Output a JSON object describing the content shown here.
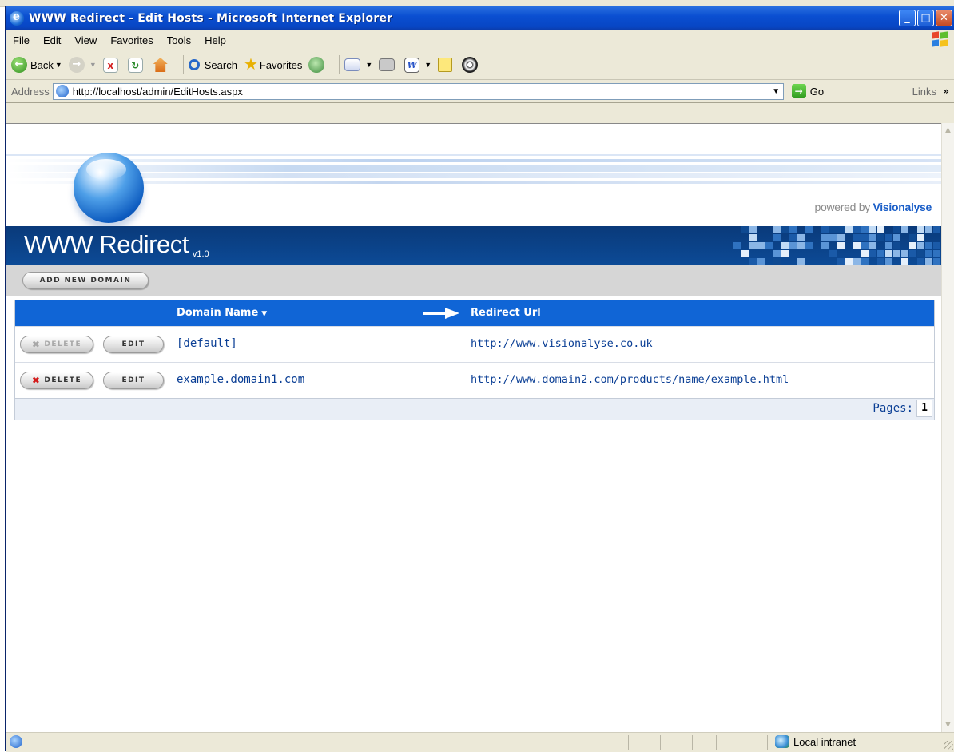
{
  "window": {
    "title": "WWW Redirect - Edit Hosts - Microsoft Internet Explorer",
    "minimize": "_",
    "maximize": "□",
    "close": "✕"
  },
  "menu": [
    "File",
    "Edit",
    "View",
    "Favorites",
    "Tools",
    "Help"
  ],
  "toolbar": {
    "back": "Back",
    "search": "Search",
    "favorites": "Favorites"
  },
  "address": {
    "label": "Address",
    "url": "http://localhost/admin/EditHosts.aspx",
    "go": "Go",
    "links": "Links"
  },
  "page": {
    "powered_by_prefix": "powered by",
    "powered_by_brand": "Visionalyse",
    "app_name": "WWW Redirect",
    "version": "v1.0",
    "add_button": "ADD NEW DOMAIN",
    "columns": {
      "domain": "Domain Name",
      "redirect": "Redirect Url"
    },
    "rows": [
      {
        "delete_label": "DELETE",
        "delete_enabled": false,
        "edit_label": "EDIT",
        "domain": "[default]",
        "redirect": "http://www.visionalyse.co.uk"
      },
      {
        "delete_label": "DELETE",
        "delete_enabled": true,
        "edit_label": "EDIT",
        "domain": "example.domain1.com",
        "redirect": "http://www.domain2.com/products/name/example.html"
      }
    ],
    "pager_label": "Pages:",
    "current_page": "1"
  },
  "status": {
    "zone": "Local intranet"
  },
  "colors": {
    "title_bar": "#0a4fd1",
    "brand_bar": "#0c4a96",
    "grid_header": "#1065d6",
    "link_text": "#0b3f95",
    "delete_x": "#d41b1b"
  }
}
